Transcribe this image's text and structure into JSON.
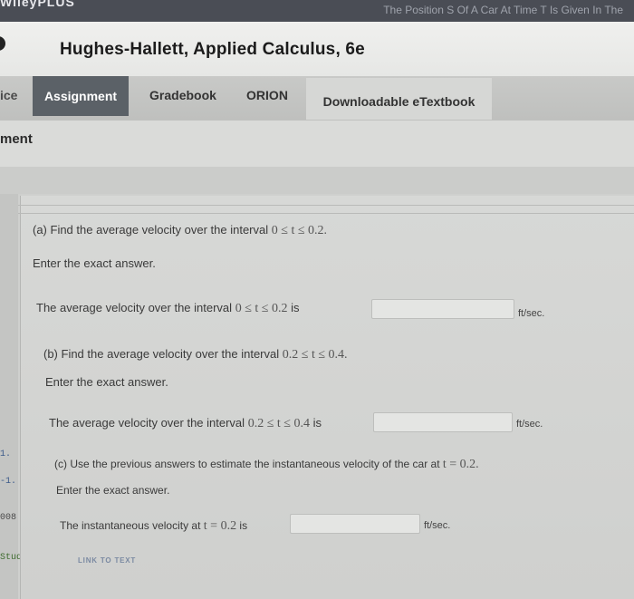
{
  "browser": {
    "brand": "WileyPLUS",
    "tab_title": "The Position S Of A Car At Time T Is Given In The"
  },
  "header": {
    "course_title": "Hughes-Hallett, Applied Calculus, 6e"
  },
  "nav": {
    "prev_fragment": "ice",
    "assignment": "Assignment",
    "gradebook": "Gradebook",
    "orion": "ORION",
    "etextbook": "Downloadable eTextbook"
  },
  "subheader": {
    "label": "ment"
  },
  "sidebar": {
    "items": [
      {
        "label": "1."
      },
      {
        "label": "-1."
      },
      {
        "label": "008"
      },
      {
        "label": "Study"
      }
    ]
  },
  "parts": {
    "a": {
      "prompt": "(a) Find the average velocity over the interval",
      "prompt_math": "0 ≤ t ≤ 0.2.",
      "instruction": "Enter the exact answer.",
      "answer_text": "The average velocity over the interval",
      "answer_math": "0 ≤ t ≤ 0.2",
      "answer_suffix": "is",
      "unit": "ft/sec."
    },
    "b": {
      "prompt": "(b) Find the average velocity over the interval",
      "prompt_math": "0.2 ≤ t ≤ 0.4.",
      "instruction": "Enter the exact answer.",
      "answer_text": "The average velocity over the interval",
      "answer_math": "0.2 ≤ t ≤ 0.4",
      "answer_suffix": "is",
      "unit": "ft/sec."
    },
    "c": {
      "prompt": "(c) Use the previous answers to estimate the instantaneous velocity of the car at",
      "prompt_math": "t = 0.2.",
      "instruction": "Enter the exact answer.",
      "answer_text": "The instantaneous velocity at",
      "answer_math": "t = 0.2",
      "answer_suffix": "is",
      "unit": "ft/sec."
    }
  },
  "link_to_text": "LINK TO TEXT"
}
